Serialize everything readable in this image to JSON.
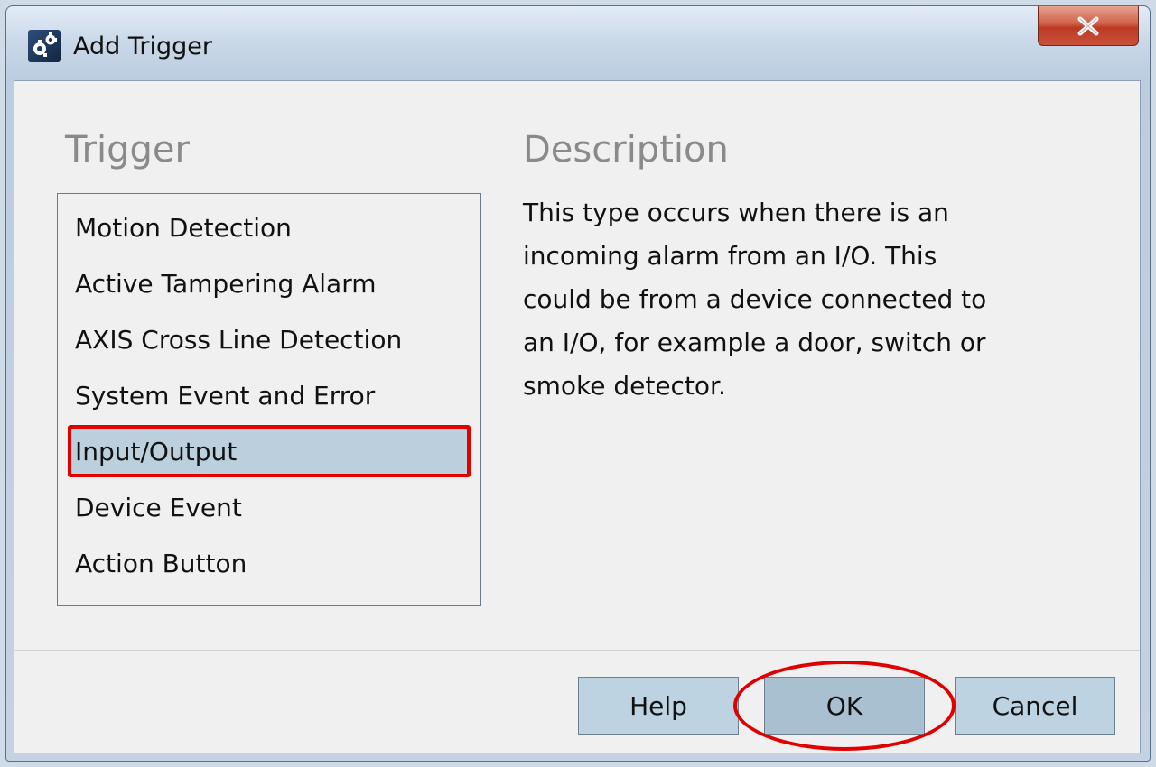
{
  "window": {
    "title": "Add Trigger",
    "app_icon": "gears-icon",
    "close_icon": "close-x-icon"
  },
  "trigger": {
    "heading": "Trigger",
    "items": [
      {
        "label": "Motion Detection"
      },
      {
        "label": "Active Tampering Alarm"
      },
      {
        "label": "AXIS Cross Line Detection"
      },
      {
        "label": "System Event and Error"
      },
      {
        "label": "Input/Output",
        "selected": true
      },
      {
        "label": "Device Event"
      },
      {
        "label": "Action Button"
      }
    ]
  },
  "description": {
    "heading": "Description",
    "lines": [
      "This type occurs when there is an",
      "incoming alarm from an I/O. This",
      "could be from a device connected to",
      "an I/O, for example a door, switch or",
      "smoke detector."
    ]
  },
  "buttons": {
    "help": "Help",
    "ok": "OK",
    "cancel": "Cancel"
  },
  "colors": {
    "selection": "#bccfdc",
    "annotation": "#e00000"
  }
}
